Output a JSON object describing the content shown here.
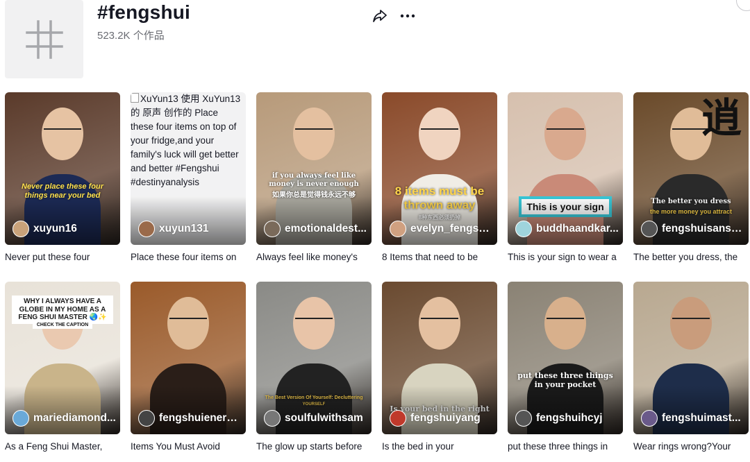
{
  "header": {
    "title": "#fengshui",
    "count": "523.2K 个作品",
    "hashtag_glyph": "#"
  },
  "videos": [
    {
      "author": "xuyun16",
      "caption": "Never put these four",
      "overlay": "Never place these four things near your bed",
      "bg": "#5a3a2a",
      "avatar": "#c9a27a",
      "shirt": "#1c2a55",
      "skin": "#e6c3a3"
    },
    {
      "author": "xuyun131",
      "caption": "Place these four items on",
      "alt": "XuYun13 使用 XuYun13 的 原声 创作的 Place these four items on top of your fridge,and your family's luck will get better and better #Fengshui #destinyanalysis",
      "bg": "#f2f2f3",
      "avatar": "#9a6a4a"
    },
    {
      "author": "emotionaldest...",
      "caption": "Always feel like money's",
      "overlay": "if you always feel like money is never enough",
      "overlay2": "如果你总是觉得钱永远不够",
      "bg": "#b79a7a",
      "avatar": "#7a6a5a",
      "shirt": "#a9a79e",
      "skin": "#e4c0a0"
    },
    {
      "author": "evelyn_fengsh...",
      "caption": "8 Items that need to be",
      "overlay": "8 items must be thrown away",
      "overlay2": "8种东西必须扔掉",
      "bg": "#8a4a2a",
      "avatar": "#d0a080",
      "shirt": "#f0ede6",
      "skin": "#f0d4c0"
    },
    {
      "author": "buddhaandkar...",
      "caption": "This is your sign to wear a",
      "overlay": "This is your sign",
      "bg": "#d6c0ae",
      "avatar": "#9fd4dc",
      "shirt": "#c98a78",
      "skin": "#d9a98e"
    },
    {
      "author": "fengshuisansh...",
      "caption": "The better you dress, the",
      "overlay": "The better you dress",
      "overlay2": "the more money you attract",
      "glyph": "逍",
      "bg": "#6a4a2a",
      "avatar": "#555555",
      "shirt": "#2a2a2a",
      "skin": "#e0bc98"
    },
    {
      "author": "mariediamond...",
      "caption": "As a Feng Shui Master,",
      "overlay": "WHY I ALWAYS HAVE A GLOBE IN MY HOME AS A FENG SHUI MASTER 🌏✨",
      "overlay2": "CHECK THE CAPTION",
      "bg": "#e8e2d8",
      "avatar": "#6aa9d8",
      "shirt": "#c9b48a",
      "skin": "#eac9b0"
    },
    {
      "author": "fengshuienerg...",
      "caption": "Items You Must Avoid",
      "bg": "#9a5a2a",
      "avatar": "#444444",
      "shirt": "#2a1e18",
      "skin": "#e0bc98"
    },
    {
      "author": "soulfulwithsam",
      "caption": "The glow up starts before",
      "overlay": "The Best Version Of Yourself: Decluttering",
      "overlay2": "YOURSELF",
      "bg": "#8a8a86",
      "avatar": "#777777",
      "shirt": "#222222",
      "skin": "#e8c4a8"
    },
    {
      "author": "fengshuiyang",
      "caption": "Is the bed in your",
      "overlay": "Is your bed in the right",
      "bg": "#6a4a30",
      "avatar": "#c0392b",
      "shirt": "#d8d4c0",
      "skin": "#e4c0a0"
    },
    {
      "author": "fengshuihcyj",
      "caption": "put these three things in",
      "overlay": "put these three things in your pocket",
      "bg": "#8a8274",
      "avatar": "#555555",
      "shirt": "#1a1a1a",
      "skin": "#d8b08c"
    },
    {
      "author": "fengshuimast...",
      "caption": "Wear rings wrong?Your",
      "bg": "#b8a890",
      "avatar": "#6a5a8a",
      "shirt": "#1e2d4a",
      "skin": "#c99c7c"
    }
  ],
  "colors": {
    "text": "#161823",
    "muted": "#6b6c73",
    "thumb_placeholder": "#f1f1f2"
  },
  "icons": {
    "share": "share-arrow-icon",
    "more": "more-dots-icon",
    "hashtag": "hashtag-icon"
  }
}
